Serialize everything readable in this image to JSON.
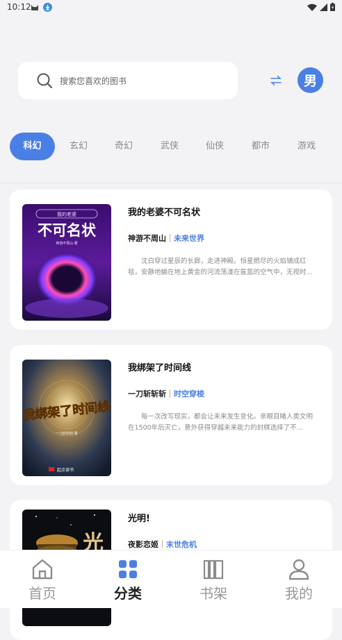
{
  "status_bar": {
    "time": "10:12"
  },
  "search": {
    "placeholder": "搜索您喜欢的图书"
  },
  "header": {
    "gender_label": "男",
    "accent_color": "#4a7fe6"
  },
  "categories": [
    {
      "label": "科幻",
      "active": true
    },
    {
      "label": "玄幻",
      "active": false
    },
    {
      "label": "奇幻",
      "active": false
    },
    {
      "label": "武侠",
      "active": false
    },
    {
      "label": "仙侠",
      "active": false
    },
    {
      "label": "都市",
      "active": false
    },
    {
      "label": "游戏",
      "active": false
    }
  ],
  "books": [
    {
      "title": "我的老婆不可名状",
      "author": "神游不周山",
      "genre": "未来世界",
      "description": "沈白穿过星辰的长廊，走进神殿。恒星燃尽的火焰铺成红毯，安静地躺在地上黄金的河流荡漾在氤氲的空气中，无视时...",
      "cover_text": "不可名状",
      "cover_small": "我的老婆",
      "cover_author": "神游不周山·著"
    },
    {
      "title": "我绑架了时间线",
      "author": "一刀斩斩斩",
      "genre": "时空穿梭",
      "description": "每一次改写现实，都会让未来发生变化。亲眼目睹人类文明在1500年后灭亡，意外获得穿越未来能力的封棋选择了不...",
      "cover_text": "我绑架了时间线",
      "cover_author": "一刀斩斩斩·著",
      "cover_publisher": "起点读书"
    },
    {
      "title": "光明!",
      "author": "夜影恋姬",
      "genre": "末世危机",
      "cover_text": "光"
    }
  ],
  "bottom_nav": [
    {
      "label": "首页",
      "icon": "home-icon",
      "active": false
    },
    {
      "label": "分类",
      "icon": "category-grid-icon",
      "active": true
    },
    {
      "label": "书架",
      "icon": "bookshelf-icon",
      "active": false
    },
    {
      "label": "我的",
      "icon": "user-icon",
      "active": false
    }
  ]
}
